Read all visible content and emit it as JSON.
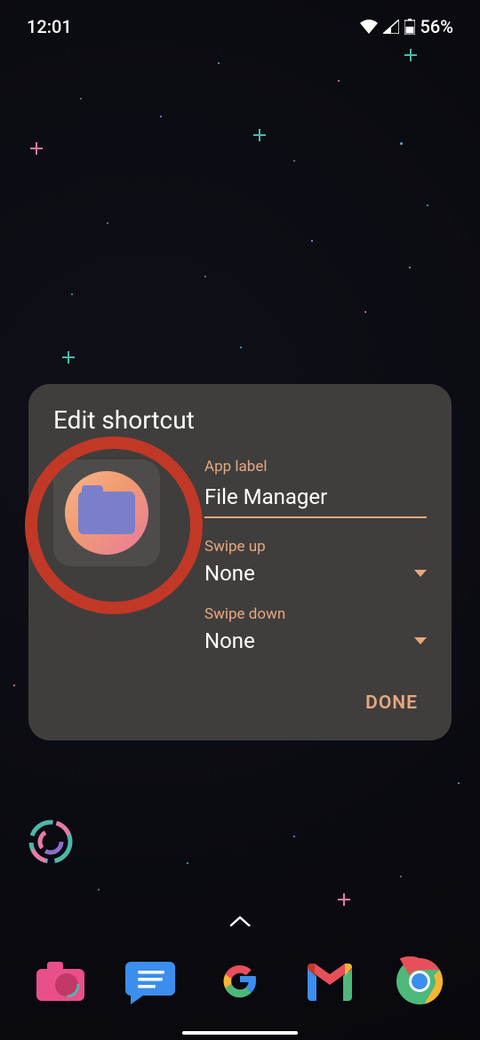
{
  "status": {
    "time": "12:01",
    "battery_percent": "56%"
  },
  "dialog": {
    "title": "Edit shortcut",
    "app_label_field": "App label",
    "app_label_value": "File Manager",
    "swipe_up_label": "Swipe up",
    "swipe_up_value": "None",
    "swipe_down_label": "Swipe down",
    "swipe_down_value": "None",
    "done_label": "DONE"
  },
  "dock": {
    "items": [
      "camera",
      "messages",
      "google",
      "gmail",
      "chrome"
    ]
  }
}
